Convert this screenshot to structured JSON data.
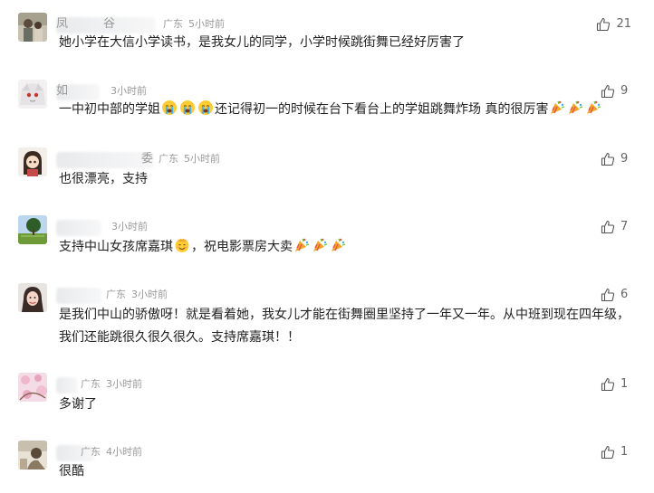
{
  "comments": [
    {
      "name_fragment": "凤　　　谷",
      "location": "广东",
      "time": "5小时前",
      "text": "她小学在大信小学读书，是我女儿的同学，小学时候跳街舞已经好厉害了",
      "likes": "21"
    },
    {
      "name_fragment": "如",
      "location": "",
      "time": "3小时前",
      "text_before": "一中初中部的学姐",
      "text_after": "还记得初一的时候在台下看台上的学姐跳舞炸场 真的很厉害",
      "likes": "9"
    },
    {
      "name_fragment": "委",
      "location": "广东",
      "time": "5小时前",
      "text": "也很漂亮，支持",
      "likes": "9"
    },
    {
      "name_fragment": "",
      "location": "",
      "time": "3小时前",
      "text_before": "支持中山女孩席嘉琪",
      "text_after": "，祝电影票房大卖",
      "likes": "7"
    },
    {
      "name_fragment": "",
      "location": "广东",
      "time": "3小时前",
      "text": "是我们中山的骄傲呀！就是看着她，我女儿才能在街舞圈里坚持了一年又一年。从中班到现在四年级，我们还能跳很久很久很久。支持席嘉琪！！",
      "likes": "6"
    },
    {
      "name_fragment": "",
      "location": "广东",
      "time": "3小时前",
      "text": "多谢了",
      "likes": "1"
    },
    {
      "name_fragment": "",
      "location": "广东",
      "time": "4小时前",
      "text": "很酷",
      "likes": "1"
    }
  ],
  "icons": {
    "like": "thumbs-up-icon",
    "cry": "loudly-crying-face-icon",
    "party": "party-popper-icon",
    "smile": "smiling-face-icon"
  },
  "colors": {
    "text": "#222222",
    "meta": "#999999",
    "count": "#666666"
  }
}
